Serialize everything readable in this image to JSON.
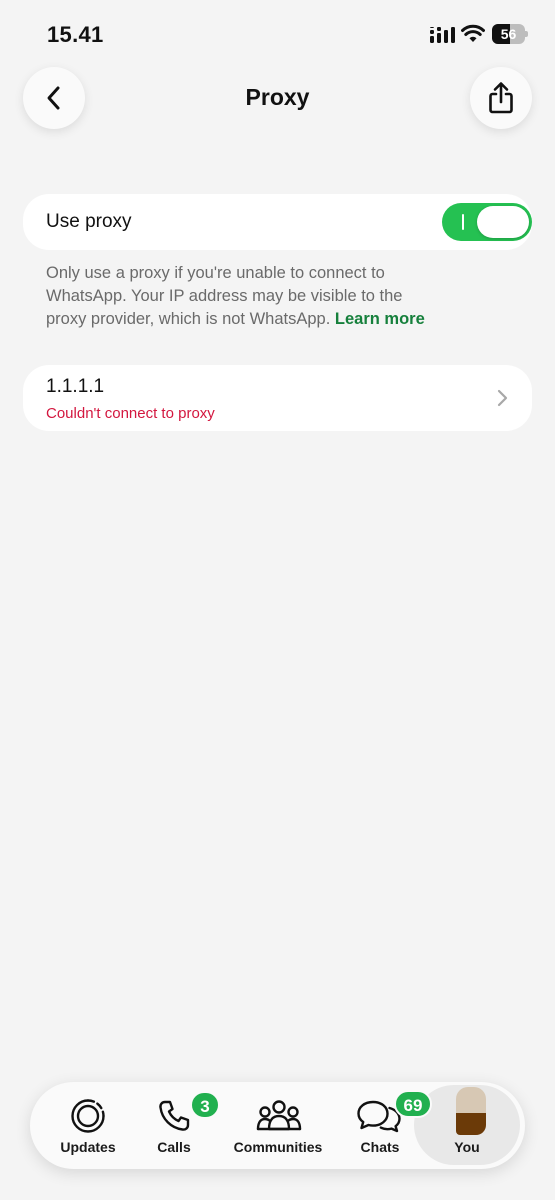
{
  "status_bar": {
    "time": "15.41",
    "battery_level": "56",
    "battery_fraction": 0.56
  },
  "header": {
    "title": "Proxy",
    "back_icon": "chevron-left-icon",
    "share_icon": "share-icon"
  },
  "use_proxy": {
    "label": "Use proxy",
    "enabled": true,
    "toggle_color": "#25c152"
  },
  "description": {
    "text": "Only use a proxy if you're unable to connect to WhatsApp. Your IP address may be visible to the proxy provider, which is not WhatsApp.",
    "link": "Learn more",
    "link_color": "#16803c"
  },
  "proxy_entry": {
    "address": "1.1.1.1",
    "status": "Couldn't connect to proxy",
    "status_color": "#d3173f"
  },
  "tab_bar": {
    "tabs": [
      {
        "label": "Updates",
        "icon": "updates-icon"
      },
      {
        "label": "Calls",
        "icon": "phone-icon",
        "badge": "3"
      },
      {
        "label": "Communities",
        "icon": "communities-icon"
      },
      {
        "label": "Chats",
        "icon": "chats-icon",
        "badge": "69"
      },
      {
        "label": "You",
        "icon": "avatar",
        "selected": true
      }
    ],
    "badge_color": "#21b04f"
  }
}
